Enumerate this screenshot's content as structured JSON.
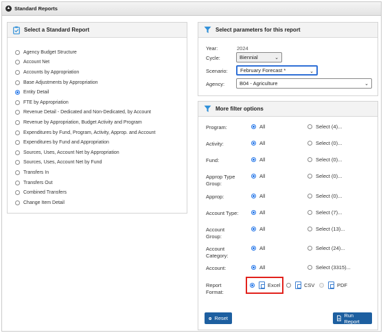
{
  "header": {
    "title": "Standard Reports"
  },
  "left_panel": {
    "title": "Select a Standard Report",
    "reports": [
      {
        "label": "Agency Budget Structure",
        "selected": false
      },
      {
        "label": "Account Net",
        "selected": false
      },
      {
        "label": "Accounts by Appropriation",
        "selected": false
      },
      {
        "label": "Base Adjustments by Appropriation",
        "selected": false
      },
      {
        "label": "Entity Detail",
        "selected": true
      },
      {
        "label": "FTE by Appropriation",
        "selected": false
      },
      {
        "label": "Revenue Detail - Dedicated and Non-Dedicated, by Account",
        "selected": false
      },
      {
        "label": "Revenue by Appropriation, Budget Activity and Program",
        "selected": false
      },
      {
        "label": "Expenditures by Fund, Program, Activity, Approp. and Account",
        "selected": false
      },
      {
        "label": "Expenditures by Fund and Appropriation",
        "selected": false
      },
      {
        "label": "Sources, Uses, Account Net by Appropriation",
        "selected": false
      },
      {
        "label": "Sources, Uses, Account Net by Fund",
        "selected": false
      },
      {
        "label": "Transfers In",
        "selected": false
      },
      {
        "label": "Transfers Out",
        "selected": false
      },
      {
        "label": "Combined Transfers",
        "selected": false
      },
      {
        "label": "Change Item Detail",
        "selected": false
      }
    ]
  },
  "params": {
    "title": "Select parameters for this report",
    "year_label": "Year:",
    "year_value": "2024",
    "cycle_label": "Cycle:",
    "cycle_value": "Biennial",
    "scenario_label": "Scenario:",
    "scenario_value": "February Forecast *",
    "agency_label": "Agency:",
    "agency_value": "B04 - Agriculture"
  },
  "filters": {
    "title": "More filter options",
    "all_label": "All",
    "rows": [
      {
        "label": "Program:",
        "select_label": "Select (4)..."
      },
      {
        "label": "Activity:",
        "select_label": "Select (0)..."
      },
      {
        "label": "Fund:",
        "select_label": "Select (0)..."
      },
      {
        "label": "Approp Type\nGroup:",
        "select_label": "Select (0)..."
      },
      {
        "label": "Approp:",
        "select_label": "Select (0)..."
      },
      {
        "label": "Account Type:",
        "select_label": "Select (7)..."
      },
      {
        "label": "Account\nGroup:",
        "select_label": "Select (13)..."
      },
      {
        "label": "Account\nCategory:",
        "select_label": "Select (24)..."
      },
      {
        "label": "Account:",
        "select_label": "Select (3315)..."
      }
    ],
    "format_label": "Report\nFormat:",
    "formats": [
      {
        "label": "Excel",
        "selected": true
      },
      {
        "label": "CSV",
        "selected": false
      },
      {
        "label": "PDF",
        "selected": false
      }
    ],
    "reset_label": "Reset",
    "run_label": "Run Report"
  },
  "colors": {
    "accent": "#1d5fa0",
    "radio_selected": "#1e72e8",
    "highlight": "#e1211b",
    "filter_icon": "#2f8fd8"
  }
}
